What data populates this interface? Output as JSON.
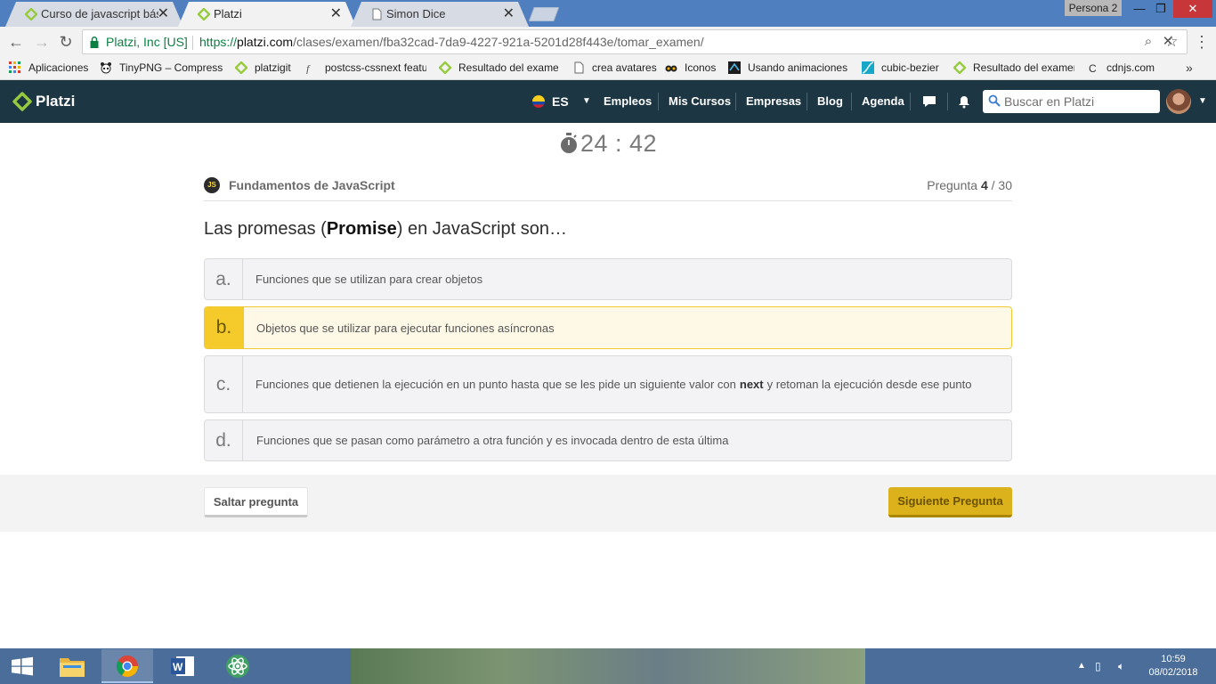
{
  "browser": {
    "tabs": [
      {
        "title": "Curso de javascript básico",
        "active": false
      },
      {
        "title": "Platzi",
        "active": true
      },
      {
        "title": "Simon Dice",
        "active": false
      }
    ],
    "profile": "Persona 2",
    "site_identity": "Platzi, Inc [US]",
    "url": {
      "scheme": "https://",
      "host": "platzi.com",
      "path": "/clases/examen/fba32cad-7da9-4227-921a-5201d28f443e/tomar_examen/"
    },
    "bookmarks": [
      {
        "label": "Aplicaciones",
        "icon": "apps-icon"
      },
      {
        "label": "TinyPNG – Compress",
        "icon": "panda-icon"
      },
      {
        "label": "platzigit",
        "icon": "platzi-icon"
      },
      {
        "label": "postcss-cssnext featu",
        "icon": "postcss-icon"
      },
      {
        "label": "Resultado del examen",
        "icon": "platzi-icon"
      },
      {
        "label": "crea avatares",
        "icon": "page-icon"
      },
      {
        "label": "Iconos",
        "icon": "binoculars-icon"
      },
      {
        "label": "Usando animaciones",
        "icon": "mdn-icon"
      },
      {
        "label": "cubic-bezier",
        "icon": "bezier-icon"
      },
      {
        "label": "Resultado del examen",
        "icon": "platzi-icon"
      },
      {
        "label": "cdnjs.com",
        "icon": "cdnjs-icon"
      }
    ],
    "bookmarks_more": "»"
  },
  "header": {
    "logo": "Platzi",
    "language": "ES",
    "nav": [
      "Empleos",
      "Mis Cursos",
      "Empresas",
      "Blog",
      "Agenda"
    ],
    "search_placeholder": "Buscar en Platzi"
  },
  "exam": {
    "timer": "24 : 42",
    "course_badge": "JS",
    "course": "Fundamentos de JavaScript",
    "counter_label": "Pregunta",
    "current": "4",
    "total": "/ 30",
    "question": {
      "before": "Las promesas (",
      "bold": "Promise",
      "after": ") en JavaScript son…"
    },
    "options": [
      {
        "letter": "a.",
        "text": "Funciones que se utilizan para crear objetos",
        "selected": false
      },
      {
        "letter": "b.",
        "text": "Objetos que se utilizar para ejecutar funciones asíncronas",
        "selected": true
      },
      {
        "letter": "c.",
        "text_before": "Funciones que detienen la ejecución en un punto hasta que se les pide un siguiente valor con",
        "text_bold": "next",
        "text_after": "y retoman la ejecución desde ese punto",
        "selected": false
      },
      {
        "letter": "d.",
        "text": "Funciones que se pasan como parámetro a otra función y es invocada dentro de esta última",
        "selected": false
      }
    ],
    "skip_label": "Saltar pregunta",
    "next_label": "Siguiente Pregunta"
  },
  "taskbar": {
    "apps": [
      "file-explorer-icon",
      "chrome-icon",
      "word-icon",
      "atom-icon"
    ],
    "time": "10:59",
    "date": "08/02/2018"
  },
  "colors": {
    "header_bg": "#1c3643",
    "accent": "#f4cb2b",
    "platzi_green": "#98ca3f"
  }
}
